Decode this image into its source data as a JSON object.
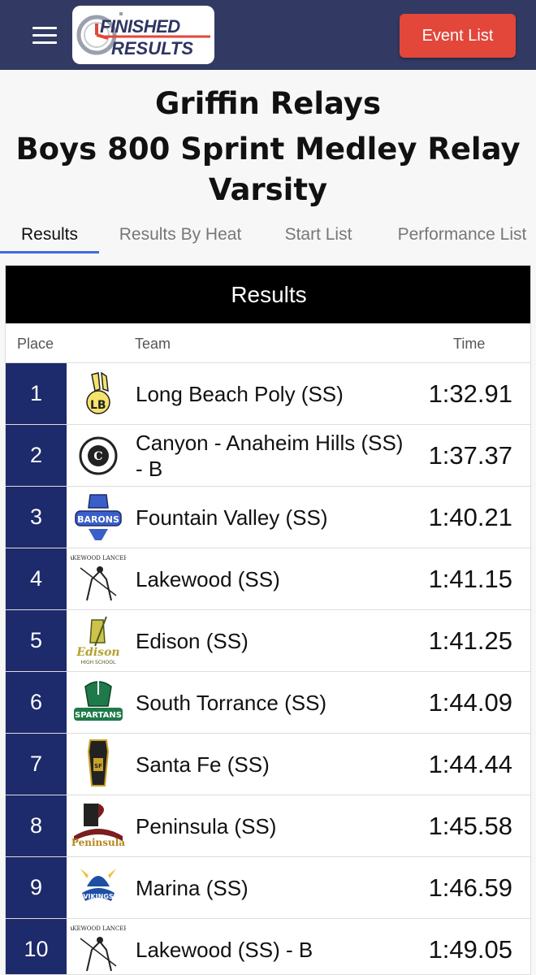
{
  "header": {
    "menu_icon": "hamburger-menu-icon",
    "logo": {
      "line1": "FINISHED",
      "line2": "RESULTS"
    },
    "event_list_label": "Event List",
    "accent_color": "#e2473a",
    "bar_color": "#323a63"
  },
  "titles": {
    "meet": "Griffin Relays",
    "event": "Boys 800 Sprint Medley Relay",
    "division": "Varsity"
  },
  "tabs": [
    {
      "label": "Results",
      "active": true
    },
    {
      "label": "Results By Heat",
      "active": false
    },
    {
      "label": "Start List",
      "active": false
    },
    {
      "label": "Performance List",
      "active": false
    }
  ],
  "results": {
    "heading": "Results",
    "columns": {
      "place": "Place",
      "team": "Team",
      "time": "Time"
    },
    "rows": [
      {
        "place": "1",
        "team": "Long Beach Poly (SS)",
        "time": "1:32.91",
        "logo": "long-beach-poly-logo"
      },
      {
        "place": "2",
        "team": "Canyon - Anaheim Hills (SS) - B",
        "time": "1:37.37",
        "logo": "canyon-high-school-logo"
      },
      {
        "place": "3",
        "team": "Fountain Valley (SS)",
        "time": "1:40.21",
        "logo": "fountain-valley-barons-logo"
      },
      {
        "place": "4",
        "team": "Lakewood (SS)",
        "time": "1:41.15",
        "logo": "lakewood-lancers-logo"
      },
      {
        "place": "5",
        "team": "Edison (SS)",
        "time": "1:41.25",
        "logo": "edison-high-school-logo"
      },
      {
        "place": "6",
        "team": "South Torrance (SS)",
        "time": "1:44.09",
        "logo": "south-torrance-spartans-logo"
      },
      {
        "place": "7",
        "team": "Santa Fe (SS)",
        "time": "1:44.44",
        "logo": "santa-fe-logo"
      },
      {
        "place": "8",
        "team": "Peninsula (SS)",
        "time": "1:45.58",
        "logo": "peninsula-logo"
      },
      {
        "place": "9",
        "team": "Marina (SS)",
        "time": "1:46.59",
        "logo": "marina-vikings-logo"
      },
      {
        "place": "10",
        "team": "Lakewood (SS) - B",
        "time": "1:49.05",
        "logo": "lakewood-lancers-logo"
      }
    ]
  }
}
